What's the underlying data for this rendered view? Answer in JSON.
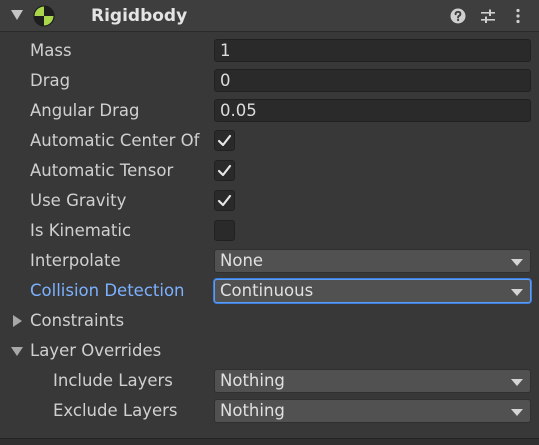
{
  "component": {
    "title": "Rigidbody",
    "icon": "rigidbody-icon",
    "header_icons": [
      "help-icon",
      "preset-settings-icon",
      "more-menu-icon"
    ]
  },
  "fields": {
    "mass": {
      "label": "Mass",
      "value": "1"
    },
    "drag": {
      "label": "Drag",
      "value": "0"
    },
    "angular_drag": {
      "label": "Angular Drag",
      "value": "0.05"
    },
    "automatic_center": {
      "label": "Automatic Center Of",
      "checked": true
    },
    "automatic_tensor": {
      "label": "Automatic Tensor",
      "checked": true
    },
    "use_gravity": {
      "label": "Use Gravity",
      "checked": true
    },
    "is_kinematic": {
      "label": "Is Kinematic",
      "checked": false
    },
    "interpolate": {
      "label": "Interpolate",
      "value": "None"
    },
    "collision_detection": {
      "label": "Collision Detection",
      "value": "Continuous"
    },
    "constraints": {
      "label": "Constraints",
      "expanded": false
    },
    "layer_overrides": {
      "label": "Layer Overrides",
      "expanded": true,
      "include_layers": {
        "label": "Include Layers",
        "value": "Nothing"
      },
      "exclude_layers": {
        "label": "Exclude Layers",
        "value": "Nothing"
      }
    }
  },
  "colors": {
    "background": "#383838",
    "header": "#3e3e3e",
    "focused_label": "#7cb1ff",
    "focus_outline": "#3b7fe0"
  }
}
